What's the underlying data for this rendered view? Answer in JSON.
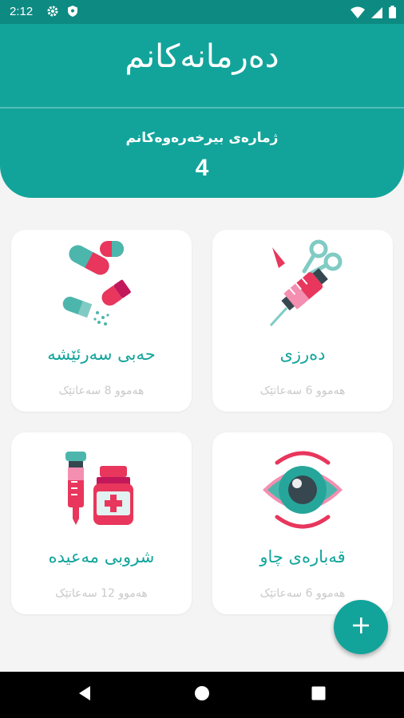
{
  "status_bar": {
    "time": "2:12"
  },
  "header": {
    "title": "دەرمانەکانم",
    "reminder_label": "ژمارەی بیرخەرەوەکانم",
    "reminder_count": "4"
  },
  "cards": [
    {
      "title": "حەبی سەرئێشە",
      "subtitle": "هەموو 8 سەعاتێک",
      "icon": "pills-icon"
    },
    {
      "title": "دەرزی",
      "subtitle": "هەموو 6 سەعاتێک",
      "icon": "syringe-icon"
    },
    {
      "title": "شروبی مەعیدە",
      "subtitle": "هەموو 12 سەعاتێک",
      "icon": "syrup-icon"
    },
    {
      "title": "قەبارەی چاو",
      "subtitle": "هەموو 6 سەعاتێک",
      "icon": "eye-drops-icon"
    }
  ],
  "fab": {
    "icon": "plus-icon"
  },
  "colors": {
    "primary": "#12a49b",
    "status_bar": "#0d8a82",
    "accent": "#e8365c",
    "card_subtitle": "#c9c9c9"
  }
}
